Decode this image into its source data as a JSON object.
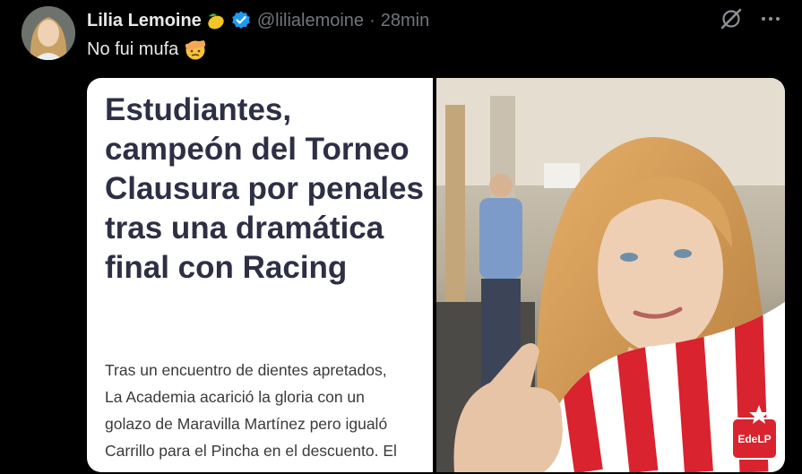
{
  "tweet": {
    "author": {
      "display_name": "Lilia Lemoine",
      "handle": "@lilialemoine",
      "name_emoji": "lemon-icon",
      "verified_badge": "verified-icon"
    },
    "separator": "·",
    "timestamp": "28min",
    "text": "No fui mufa",
    "text_emoji": "face-with-bandage-icon",
    "actions": {
      "grok_icon": "grok-icon",
      "more_icon": "more-icon"
    }
  },
  "media": {
    "article": {
      "headline": "Estudiantes, campeón del Torneo Clausura por penales tras una dramática final con Racing",
      "body": "Tras un encuentro de dientes apretados,\nLa Academia acarició la gloria con un\ngolazo de Maravilla Martínez pero igualó\nCarrillo para el Pincha en el descuento. El"
    },
    "photo": {
      "jersey_text": "EdeLP"
    }
  },
  "colors": {
    "background": "#000000",
    "primary_text": "#e7e9ea",
    "secondary_text": "#71767b",
    "verified_blue": "#1d9bf0",
    "headline": "#2e2f45",
    "jersey_red": "#d9232e"
  }
}
